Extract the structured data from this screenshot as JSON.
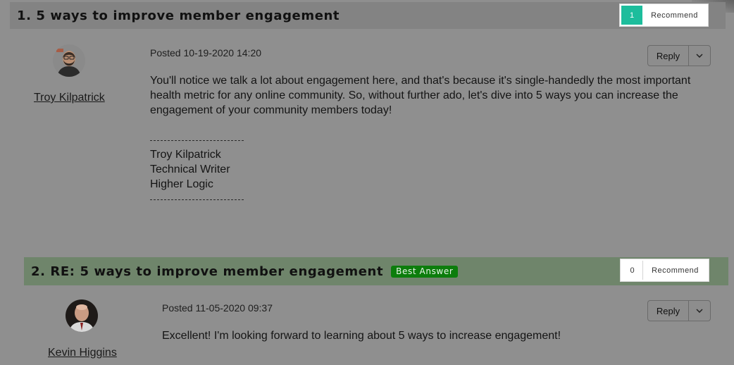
{
  "thread": [
    {
      "number_title": "1.  5 ways to improve member engagement",
      "recommend_count": "1",
      "recommend_label": "Recommend",
      "author": "Troy Kilpatrick",
      "posted": "Posted 10-19-2020 14:20",
      "reply_label": "Reply",
      "body": "You'll notice we talk a lot about engagement here, and that's because it's single-handedly the most important health metric for any online community. So, without further ado, let's dive into 5 ways you can increase the engagement of your community members today!",
      "signature": {
        "name": "Troy Kilpatrick",
        "role": "Technical Writer",
        "org": "Higher Logic"
      }
    },
    {
      "number_title": "2.  RE: 5 ways to improve member engagement",
      "badge": "Best Answer",
      "recommend_count": "0",
      "recommend_label": "Recommend",
      "author": "Kevin Higgins",
      "posted": "Posted 11-05-2020 09:37",
      "reply_label": "Reply",
      "body": "Excellent! I'm looking forward to learning about 5 ways to increase engagement!"
    }
  ],
  "colors": {
    "overlay_bg": "#8f8f8f",
    "recommend_active": "#1dbd9c",
    "best_answer": "#0c7d0c"
  }
}
